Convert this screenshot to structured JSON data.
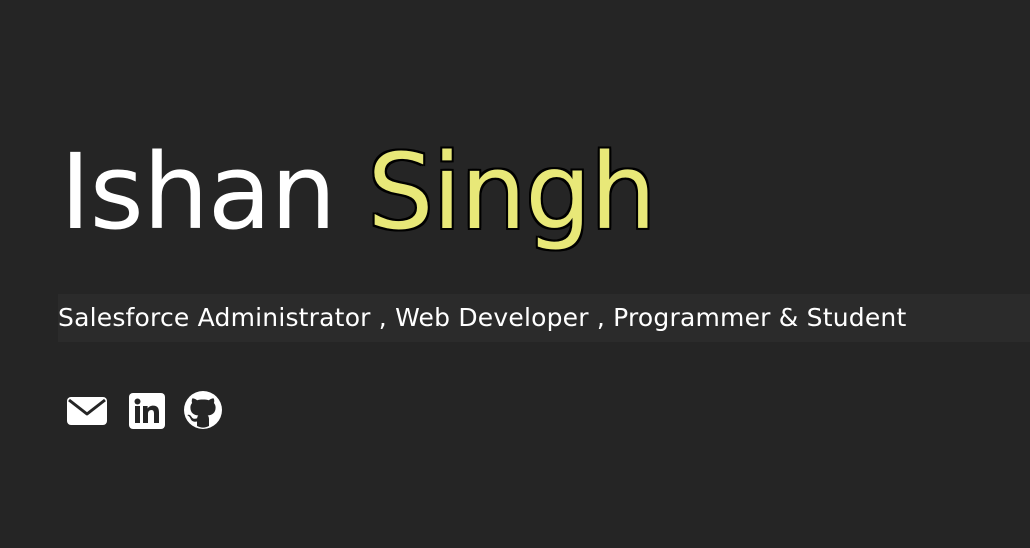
{
  "hero": {
    "first_name": "Ishan",
    "last_name": "Singh",
    "roles": "Salesforce Administrator , Web Developer , Programmer & Student"
  },
  "socials": [
    {
      "icon": "mail-icon"
    },
    {
      "icon": "linkedin-icon"
    },
    {
      "icon": "github-icon"
    }
  ],
  "colors": {
    "background": "#252525",
    "accent": "#e8e878",
    "text": "#ffffff"
  }
}
